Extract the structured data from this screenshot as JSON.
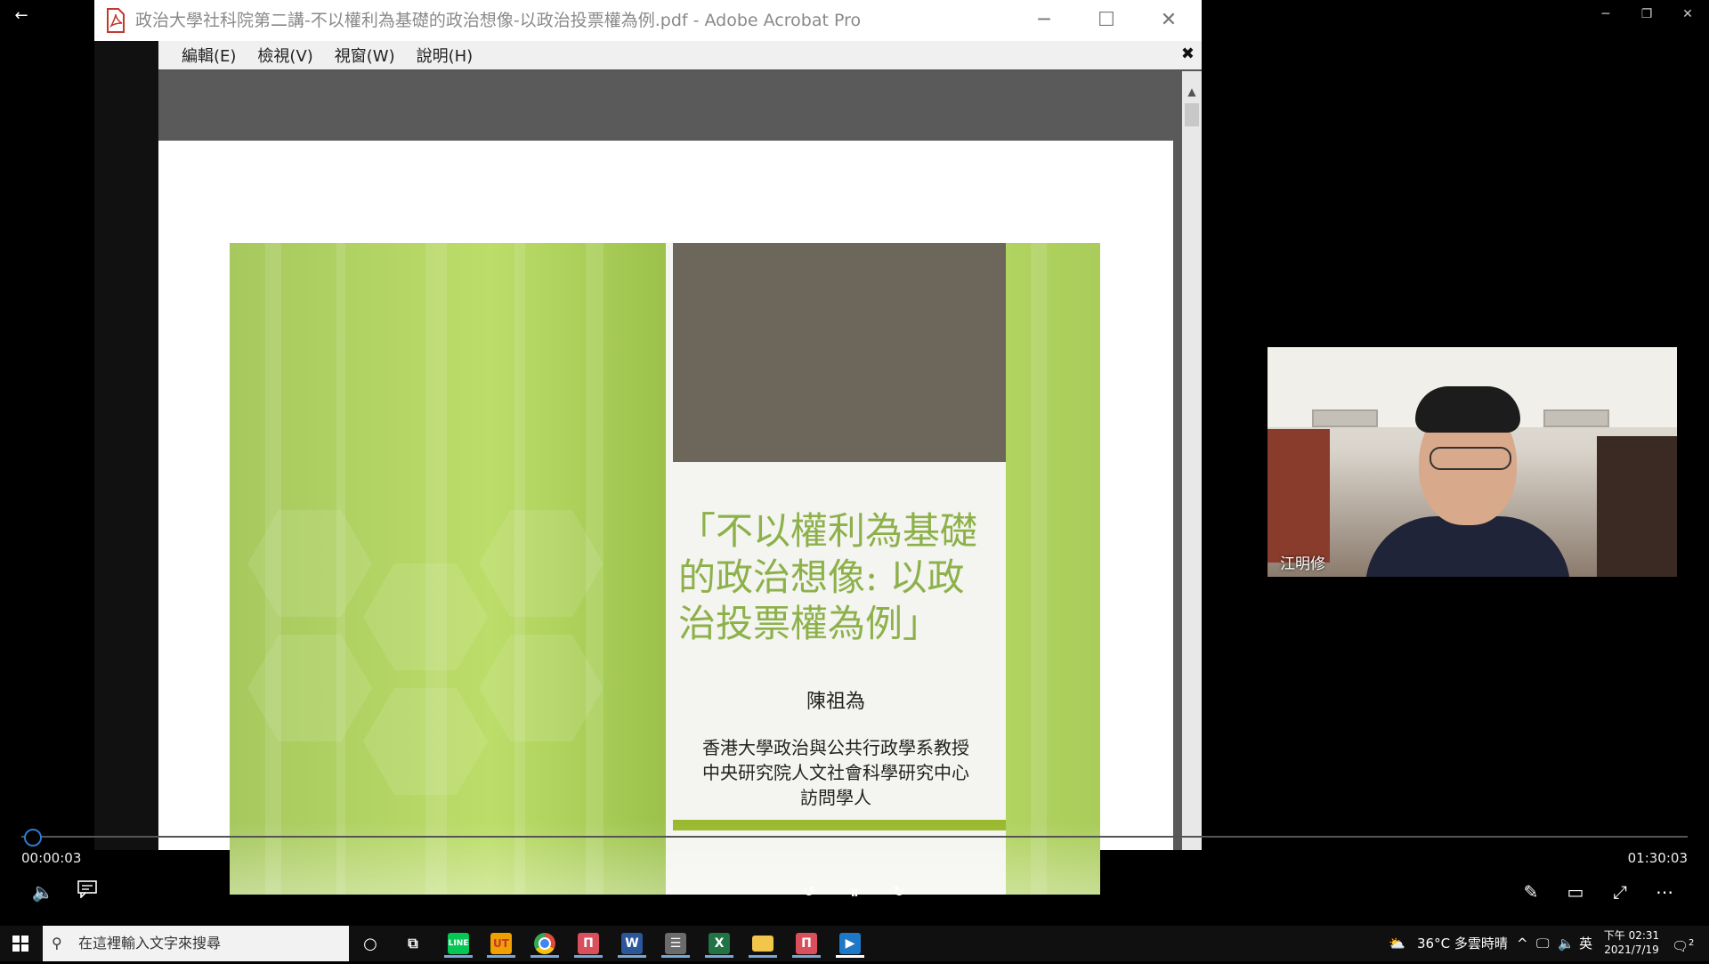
{
  "acrobat": {
    "window_title": "政治大學社科院第二講-不以權利為基礎的政治想像-以政治投票權為例.pdf - Adobe Acrobat Pro",
    "menu": [
      "編輯(E)",
      "檢視(V)",
      "視窗(W)",
      "說明(H)"
    ],
    "close_glyph": "✖"
  },
  "slide": {
    "title": "「不以權利為基礎的政治想像: 以政治投票權為例」",
    "author": "陳祖為",
    "affiliation_lines": [
      "香港大學政治與公共行政學系教授",
      "中央研究院人文社會科學研究中心",
      "訪問學人"
    ]
  },
  "participant": {
    "name": "江明修"
  },
  "player": {
    "current_time": "00:00:03",
    "total_time": "01:30:03",
    "progress_fraction": 0.001
  },
  "taskbar": {
    "search_placeholder": "在這裡輸入文字來搜尋",
    "apps": [
      {
        "name": "line-icon",
        "label": "LINE",
        "color": "#06c755"
      },
      {
        "name": "ut-icon",
        "label": "UT",
        "color": "#f0a000"
      },
      {
        "name": "chrome-icon",
        "label": "",
        "color": "#e04a3a"
      },
      {
        "name": "app-red-icon",
        "label": "",
        "color": "#d94f5c"
      },
      {
        "name": "word-icon",
        "label": "W",
        "color": "#2b579a"
      },
      {
        "name": "news-icon",
        "label": "",
        "color": "#6b6b6b"
      },
      {
        "name": "excel-icon",
        "label": "X",
        "color": "#217346"
      },
      {
        "name": "folder-icon",
        "label": "",
        "color": "#f2c64b"
      },
      {
        "name": "app-red2-icon",
        "label": "",
        "color": "#d94f5c"
      },
      {
        "name": "video-player-icon",
        "label": "",
        "color": "#1e78c8"
      }
    ],
    "weather": "36°C 多雲時晴",
    "ime": "英",
    "clock_time": "下午 02:31",
    "clock_date": "2021/7/19",
    "notification_count": "2"
  }
}
